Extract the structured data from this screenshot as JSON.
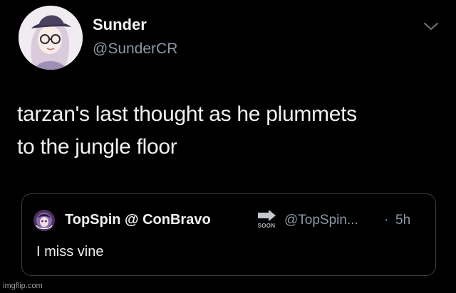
{
  "tweet": {
    "author": {
      "display_name": "Sunder",
      "handle": "@SunderCR",
      "avatar_icon": "illustrated-avatar-icon"
    },
    "text_line1": "tarzan's last thought as he plummets",
    "text_line2": "to the jungle floor",
    "menu_icon": "chevron-down-icon"
  },
  "quoted_tweet": {
    "display_name": "TopSpin @ ConBravo",
    "badge_text": "SOON",
    "handle": "@TopSpin...",
    "separator": "·",
    "time": "5h",
    "text": "I miss vine",
    "avatar_icon": "anime-avatar-icon"
  },
  "watermark": "imgflip.com",
  "colors": {
    "background": "#000000",
    "text_primary": "#f0f0f0",
    "text_secondary": "#8b98a5",
    "border": "#3a3f45"
  }
}
